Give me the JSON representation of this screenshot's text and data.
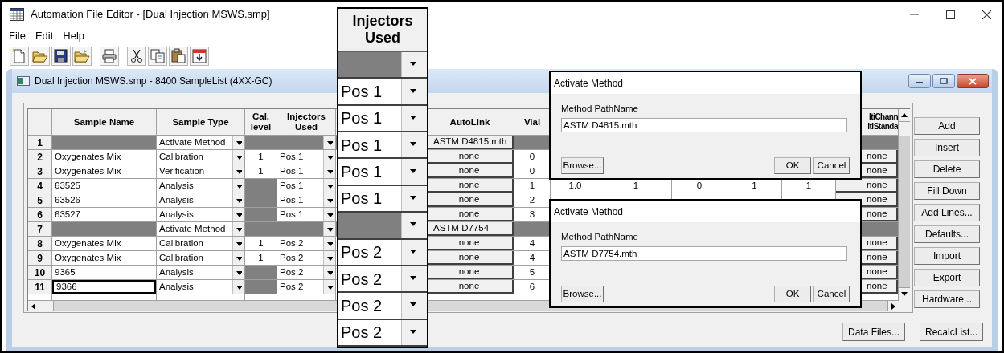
{
  "window": {
    "title": "Automation File Editor - [Dual Injection MSWS.smp]"
  },
  "menu": [
    "File",
    "Edit",
    "Help"
  ],
  "document_window": {
    "title": "Dual Injection MSWS.smp - 8400 SampleList (4XX-GC)"
  },
  "table": {
    "columns": [
      "Sample Name",
      "Sample Type",
      "Cal. level",
      "Injectors Used",
      "AutoLink",
      "Vial",
      "ltiChann ltiStanda"
    ],
    "rows": [
      {
        "number": "1",
        "kind": "method",
        "selected": false,
        "sample_type": "Activate Method",
        "autolink": "ASTM D4815.mth"
      },
      {
        "number": "2",
        "kind": "sample",
        "selected": false,
        "sample_name": "Oxygenates Mix",
        "sample_type": "Calibration",
        "cal_level": "1",
        "injector": "Pos 1",
        "autolink": "none",
        "vial": "0",
        "multichannel": "none"
      },
      {
        "number": "3",
        "kind": "sample",
        "selected": false,
        "sample_name": "Oxygenates Mix",
        "sample_type": "Verification",
        "cal_level": "1",
        "injector": "Pos 1",
        "autolink": "none",
        "vial": "0",
        "multichannel": "none"
      },
      {
        "number": "4",
        "kind": "sample",
        "selected": false,
        "sample_name": "63525",
        "sample_type": "Analysis",
        "injector": "Pos 1",
        "autolink": "none",
        "vial": "1",
        "extra": [
          "1.0",
          "1",
          "0",
          "1",
          "1"
        ],
        "multichannel": "none"
      },
      {
        "number": "5",
        "kind": "sample",
        "selected": false,
        "sample_name": "63526",
        "sample_type": "Analysis",
        "injector": "Pos 1",
        "autolink": "none",
        "vial": "2",
        "multichannel": "none"
      },
      {
        "number": "6",
        "kind": "sample",
        "selected": false,
        "sample_name": "63527",
        "sample_type": "Analysis",
        "injector": "Pos 1",
        "autolink": "none",
        "vial": "3",
        "multichannel": "none"
      },
      {
        "number": "7",
        "kind": "method",
        "selected": false,
        "sample_type": "Activate Method",
        "autolink": "ASTM D7754"
      },
      {
        "number": "8",
        "kind": "sample",
        "selected": false,
        "sample_name": "Oxygenates Mix",
        "sample_type": "Calibration",
        "cal_level": "1",
        "injector": "Pos 2",
        "autolink": "none",
        "vial": "4",
        "multichannel": "none"
      },
      {
        "number": "9",
        "kind": "sample",
        "selected": false,
        "sample_name": "Oxygenates Mix",
        "sample_type": "Calibration",
        "cal_level": "1",
        "injector": "Pos 2",
        "autolink": "none",
        "vial": "4",
        "multichannel": "none"
      },
      {
        "number": "10",
        "kind": "sample",
        "selected": false,
        "sample_name": "9365",
        "sample_type": "Analysis",
        "injector": "Pos 2",
        "autolink": "none",
        "vial": "5",
        "multichannel": "none"
      },
      {
        "number": "11",
        "kind": "sample",
        "selected": true,
        "sample_name": "9366",
        "sample_type": "Analysis",
        "injector": "Pos 2",
        "autolink": "none",
        "vial": "6",
        "multichannel": "none"
      }
    ]
  },
  "side_buttons": [
    "Add",
    "Insert",
    "Delete",
    "Fill Down",
    "Add Lines...",
    "Defaults...",
    "Import",
    "Export",
    "Hardware..."
  ],
  "bottom_buttons": [
    "Data Files...",
    "RecalcList..."
  ],
  "callout": {
    "header": "Injectors Used",
    "rows": [
      {
        "kind": "blank"
      },
      {
        "kind": "value",
        "value": "Pos 1"
      },
      {
        "kind": "value",
        "value": "Pos 1"
      },
      {
        "kind": "value",
        "value": "Pos 1"
      },
      {
        "kind": "value",
        "value": "Pos 1"
      },
      {
        "kind": "value",
        "value": "Pos 1"
      },
      {
        "kind": "blank"
      },
      {
        "kind": "value",
        "value": "Pos 2"
      },
      {
        "kind": "value",
        "value": "Pos 2"
      },
      {
        "kind": "value",
        "value": "Pos 2"
      },
      {
        "kind": "value",
        "value": "Pos 2"
      }
    ]
  },
  "dialogs": [
    {
      "title": "Activate Method",
      "label": "Method PathName",
      "value": "ASTM D4815.mth",
      "focused": false,
      "buttons": [
        "Browse...",
        "OK",
        "Cancel"
      ]
    },
    {
      "title": "Activate Method",
      "label": "Method PathName",
      "value": "ASTM D7754.mth",
      "focused": true,
      "buttons": [
        "Browse...",
        "OK",
        "Cancel"
      ]
    }
  ]
}
